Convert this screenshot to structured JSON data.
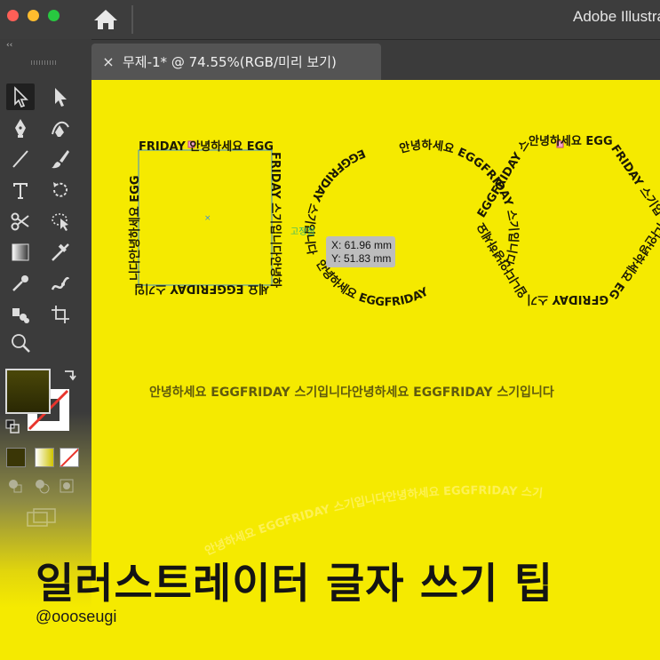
{
  "window": {
    "app_title": "Adobe Illustrator",
    "collapse_glyph": "‹‹"
  },
  "tools": [
    {
      "name": "selection-tool-icon"
    },
    {
      "name": "direct-selection-tool-icon"
    },
    {
      "name": "pen-tool-icon"
    },
    {
      "name": "curvature-tool-icon"
    },
    {
      "name": "line-tool-icon"
    },
    {
      "name": "paintbrush-tool-icon"
    },
    {
      "name": "type-tool-icon"
    },
    {
      "name": "rotate-tool-icon"
    },
    {
      "name": "scissors-tool-icon"
    },
    {
      "name": "shape-builder-tool-icon"
    },
    {
      "name": "gradient-tool-icon"
    },
    {
      "name": "blend-tool-icon"
    },
    {
      "name": "eyedropper-tool-icon"
    },
    {
      "name": "puppet-warp-tool-icon"
    },
    {
      "name": "symbol-sprayer-tool-icon"
    },
    {
      "name": "artboard-tool-icon"
    },
    {
      "name": "zoom-tool-icon"
    }
  ],
  "colors": {
    "canvas": "#f5ea00",
    "fill": "#3a3606",
    "stroke": "#ffffff",
    "selection": "#3b8fd6",
    "text_on_path": "#1c1a05",
    "line_text": "#605a0e"
  },
  "document_tab": {
    "close_glyph": "×",
    "title": "무제-1* @ 74.55%(RGB/미리 보기)"
  },
  "canvas": {
    "square_text": "FRIDAY 안녕하세요 EGGFRIDAY 스기입니다안녕하세요 EGGFRIDAY 스기입니다안녕하세요 EGG",
    "circle_text_top": "안녕하세요 EGGFRIDAY 스기입니다",
    "circle_text_left": "EGGFRIDAY 스기입니다",
    "circle_text_bottom": "안녕하세요 EGGFRIDAY 스기입니다",
    "hexagon_text": "안녕하세요 EGGFRIDAY 스기입니다안녕하세요 EGGFRIDAY 스기입니다안녕하세요 EGGFRIDAY 스기입니다",
    "anchor_label": "고정점",
    "tooltip_x": "X: 61.96 mm",
    "tooltip_y": "Y: 51.83 mm",
    "line_text": "안녕하세요 EGGFRIDAY 스기입니다안녕하세요 EGGFRIDAY 스기입니다",
    "arc_text": "안녕하세요 EGGFRIDAY 스기입니다안녕하세요 EGGFRIDAY 스기입니다"
  },
  "overlay": {
    "headline": "일러스트레이터 글자 쓰기 팁",
    "handle": "@oooseugi"
  }
}
